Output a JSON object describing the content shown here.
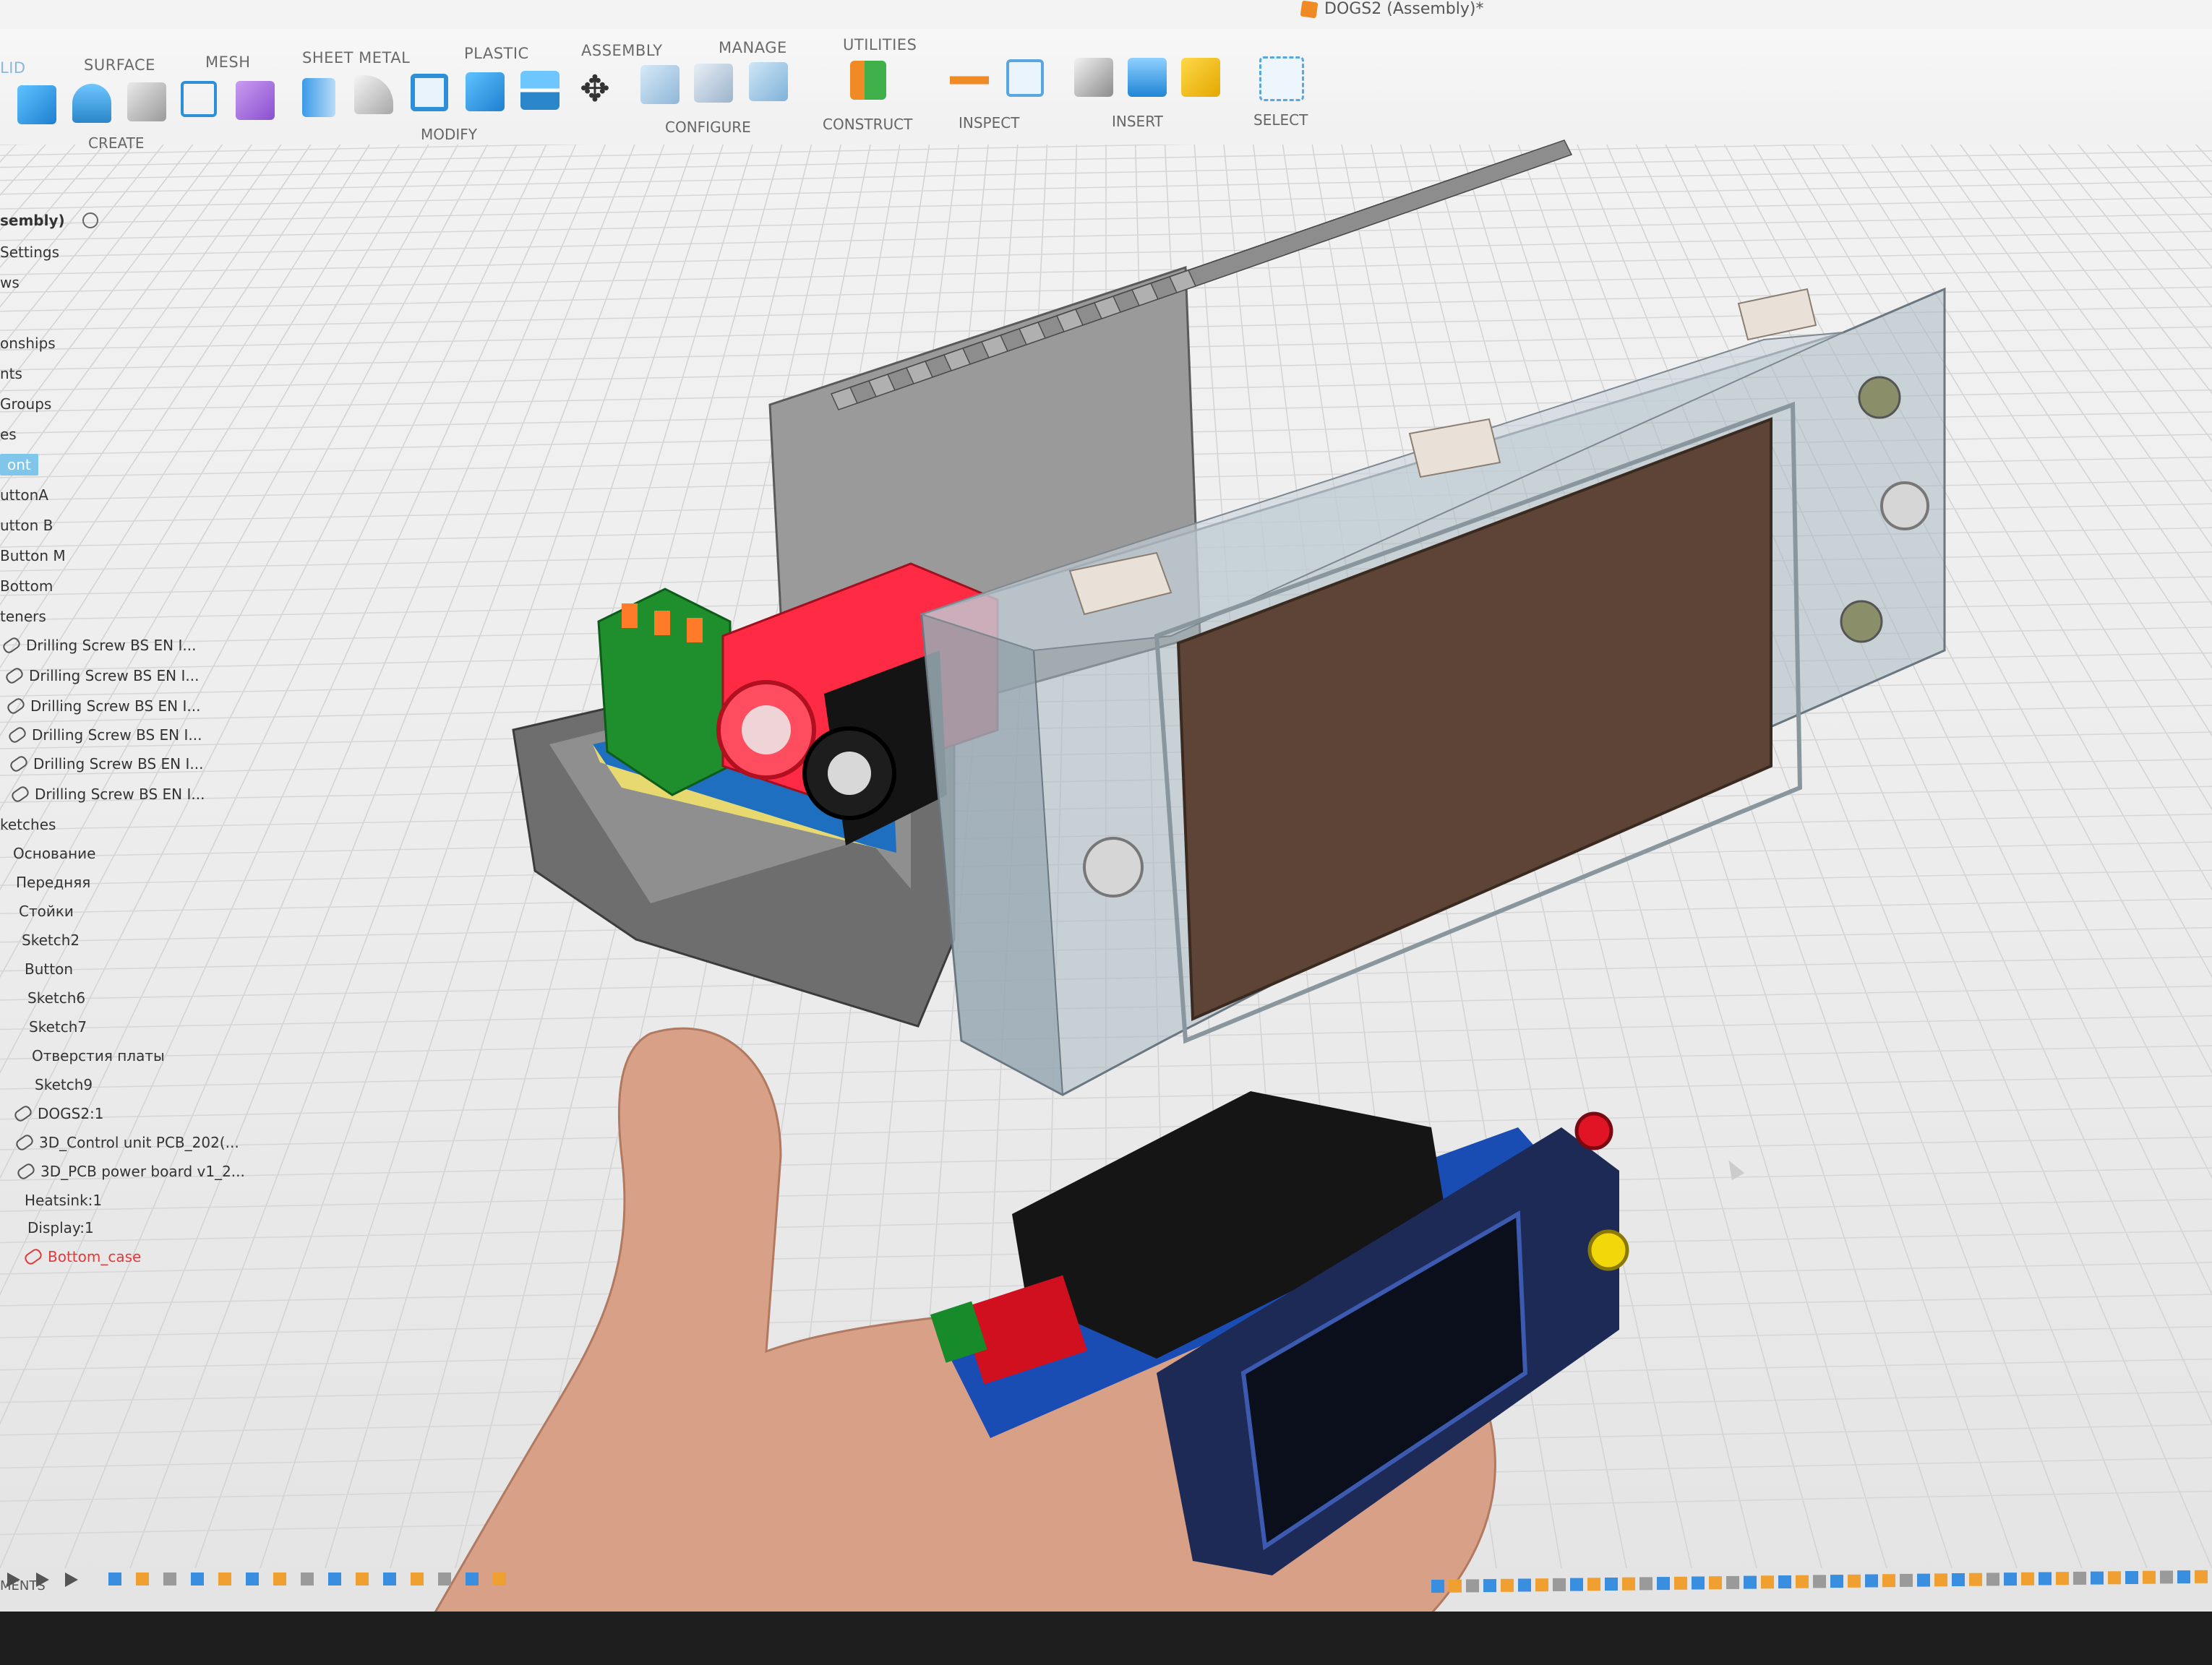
{
  "window": {
    "title": "DOGS2 (Assembly)*"
  },
  "toolbar": {
    "tabs": [
      "LID",
      "SURFACE",
      "MESH",
      "SHEET METAL",
      "PLASTIC",
      "ASSEMBLY",
      "MANAGE",
      "UTILITIES"
    ],
    "groups": [
      "CREATE",
      "MODIFY",
      "CONFIGURE",
      "CONSTRUCT",
      "INSPECT",
      "INSERT",
      "SELECT"
    ]
  },
  "browser": {
    "items": [
      "sembly)",
      "Settings",
      "ws",
      "onships",
      "nts",
      "Groups",
      "es",
      "ont",
      "uttonA",
      "utton B",
      "Button M",
      "Bottom",
      "teners",
      "Drilling Screw BS EN I...",
      "Drilling Screw BS EN I...",
      "Drilling Screw BS EN I...",
      "Drilling Screw BS EN I...",
      "Drilling Screw BS EN I...",
      "Drilling Screw BS EN I...",
      "ketches",
      "Основание",
      "Передняя",
      "Стойки",
      "Sketch2",
      "Button",
      "Sketch6",
      "Sketch7",
      "Отверстия платы",
      "Sketch9",
      "DOGS2:1",
      "3D_Control unit PCB_202(...",
      "3D_PCB power board v1_2...",
      "Heatsink:1",
      "Display:1",
      "Bottom_case"
    ]
  },
  "timeline": {
    "comments_label": "MENTS"
  },
  "colors": {
    "selected": "#7fc6ea",
    "accent_orange": "#f08a24",
    "error_red": "#e23a3a",
    "connector_green": "#1f8e2c",
    "jack_red": "#ff2b44"
  },
  "icons": {
    "create": "box-icon",
    "move": "move-arrows-icon",
    "select": "select-box-icon"
  }
}
